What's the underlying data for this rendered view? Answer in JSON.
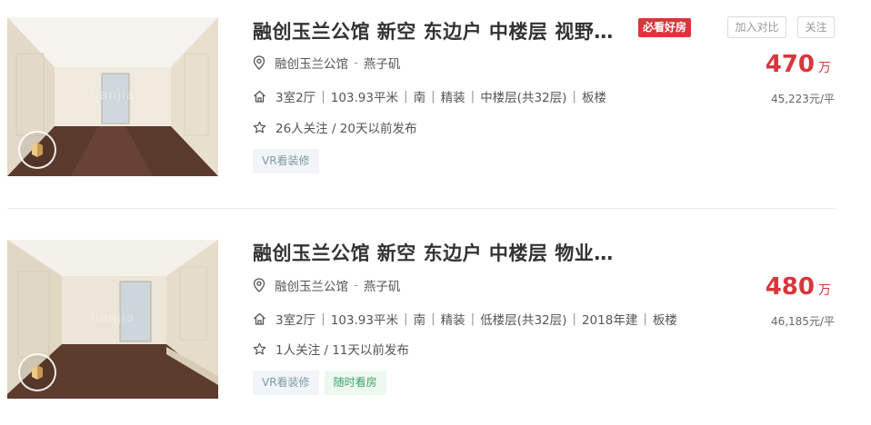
{
  "listings": [
    {
      "title": "融创玉兰公馆 新空 东边户 中楼层 视野…",
      "badge": "必看好房",
      "compare_label": "加入对比",
      "follow_label": "关注",
      "community": "融创玉兰公馆",
      "location_sep": "-",
      "area": "燕子矶",
      "info": [
        "3室2厅",
        "103.93平米",
        "南",
        "精装",
        "中楼层(共32层)",
        "板楼"
      ],
      "follow_info": "26人关注 / 20天以前发布",
      "tags": [
        "VR看装修"
      ],
      "price": "470",
      "price_unit": "万",
      "unit_price": "45,223元/平"
    },
    {
      "title": "融创玉兰公馆 新空 东边户 中楼层 物业…",
      "community": "融创玉兰公馆",
      "location_sep": "-",
      "area": "燕子矶",
      "info": [
        "3室2厅",
        "103.93平米",
        "南",
        "精装",
        "低楼层(共32层)",
        "2018年建",
        "板楼"
      ],
      "follow_info": "1人关注 / 11天以前发布",
      "tags": [
        "VR看装修",
        "随时看房"
      ],
      "price": "480",
      "price_unit": "万",
      "unit_price": "46,185元/平"
    }
  ],
  "icons": {
    "location": "location-pin-icon",
    "house": "house-icon",
    "star": "star-icon",
    "vr": "vr-icon"
  },
  "colors": {
    "price": "#d8363c",
    "badge_bg": "#d8363c",
    "vr_tag_text": "#7d99a9",
    "anytime_tag_text": "#3fa36a"
  }
}
